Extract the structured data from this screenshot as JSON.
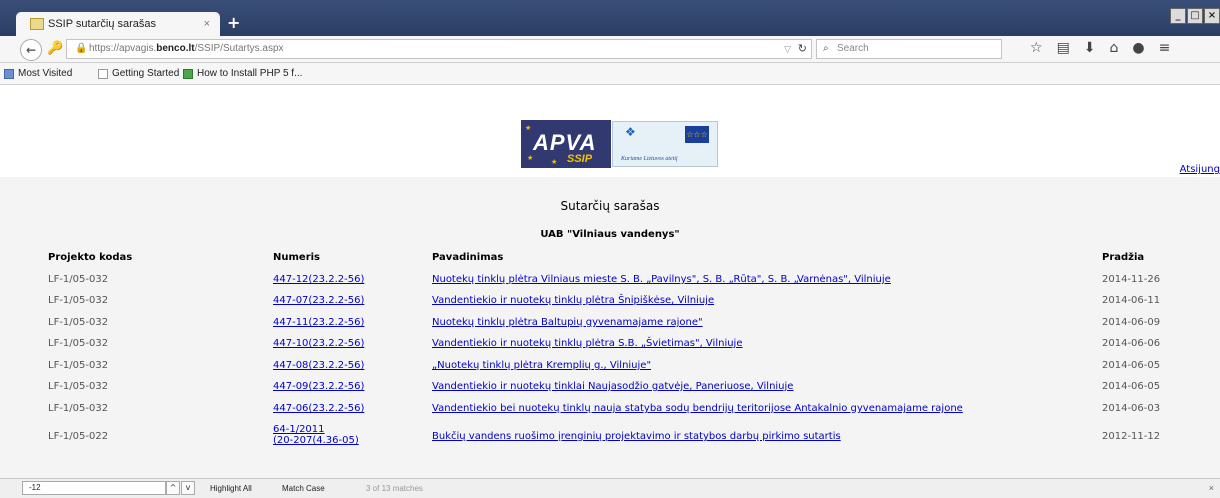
{
  "browser": {
    "tab_title": "SSIP sutarčių sarašas",
    "tab_close": "×",
    "new_tab": "+",
    "url_prefix": "https://apvagis.",
    "url_host": "benco.lt",
    "url_path": "/SSIP/Sutartys.aspx",
    "search_placeholder": "Search",
    "window_controls": [
      "_",
      "□",
      "×"
    ],
    "toolbar_icons": [
      "star-icon",
      "bookmark-list-icon",
      "download-icon",
      "home-icon",
      "chat-icon",
      "menu-icon"
    ]
  },
  "bookmarks": [
    {
      "label": "Most Visited",
      "icon": "most-visited-icon"
    },
    {
      "label": "Getting Started",
      "icon": "page-icon"
    },
    {
      "label": "How to Install PHP 5 f...",
      "icon": "php-icon"
    }
  ],
  "header": {
    "logo_apva_text": "APVA",
    "logo_apva_sub": "SSIP",
    "logo_eu_caption": "Kuriame Lietuvos ateitį",
    "logout": "Atsijung"
  },
  "page": {
    "title": "Sutarčių sarašas",
    "subtitle": "UAB \"Vilniaus vandenys\""
  },
  "table": {
    "columns": [
      "Projekto kodas",
      "Numeris",
      "Pavadinimas",
      "Pradžia"
    ],
    "rows": [
      {
        "kodas": "LF-1/05-032",
        "numeris": "447-12(23.2.2-56)",
        "numeris2": "",
        "pavadinimas": "Nuotekų tinklų plėtra Vilniaus mieste S. B. „Pavilnys\", S. B. „Rūta\", S. B. „Varnėnas\", Vilniuje",
        "pradzia": "2014-11-26"
      },
      {
        "kodas": "LF-1/05-032",
        "numeris": "447-07(23.2.2-56)",
        "numeris2": "",
        "pavadinimas": "Vandentiekio ir nuotekų tinklų plėtra Šnipiškėse, Vilniuje",
        "pradzia": "2014-06-11"
      },
      {
        "kodas": "LF-1/05-032",
        "numeris": "447-11(23.2.2-56)",
        "numeris2": "",
        "pavadinimas": "Nuotekų tinklų plėtra Baltupių gyvenamajame rajone\"",
        "pradzia": "2014-06-09"
      },
      {
        "kodas": "LF-1/05-032",
        "numeris": "447-10(23.2.2-56)",
        "numeris2": "",
        "pavadinimas": "Vandentiekio ir nuotekų tinklų plėtra S.B. „Švietimas\", Vilniuje",
        "pradzia": "2014-06-06"
      },
      {
        "kodas": "LF-1/05-032",
        "numeris": "447-08(23.2.2-56)",
        "numeris2": "",
        "pavadinimas": "„Nuotekų tinklų plėtra Kremplių g., Vilniuje\"",
        "pradzia": "2014-06-05"
      },
      {
        "kodas": "LF-1/05-032",
        "numeris": "447-09(23.2.2-56)",
        "numeris2": "",
        "pavadinimas": "Vandentiekio ir nuotekų tinklai Naujasodžio gatvėje, Paneriuose, Vilniuje",
        "pradzia": "2014-06-05"
      },
      {
        "kodas": "LF-1/05-032",
        "numeris": "447-06(23.2.2-56)",
        "numeris2": "",
        "pavadinimas": "Vandentiekio bei nuotekų tinklų nauja statyba sodų bendrijų teritorijose Antakalnio gyvenamajame rajone",
        "pradzia": "2014-06-03"
      },
      {
        "kodas": "LF-1/05-022",
        "numeris": "64-1/2011",
        "numeris2": "(20-207(4.36-05)",
        "pavadinimas": "Bukčių vandens ruošimo įrenginių projektavimo ir statybos darbų pirkimo sutartis",
        "pradzia": "2012-11-12"
      }
    ]
  },
  "findbar": {
    "value": "-12",
    "up": "^",
    "down": "v",
    "highlight_all": "Highlight All",
    "match_case": "Match Case",
    "count": "3 of 13 matches",
    "close": "×"
  }
}
